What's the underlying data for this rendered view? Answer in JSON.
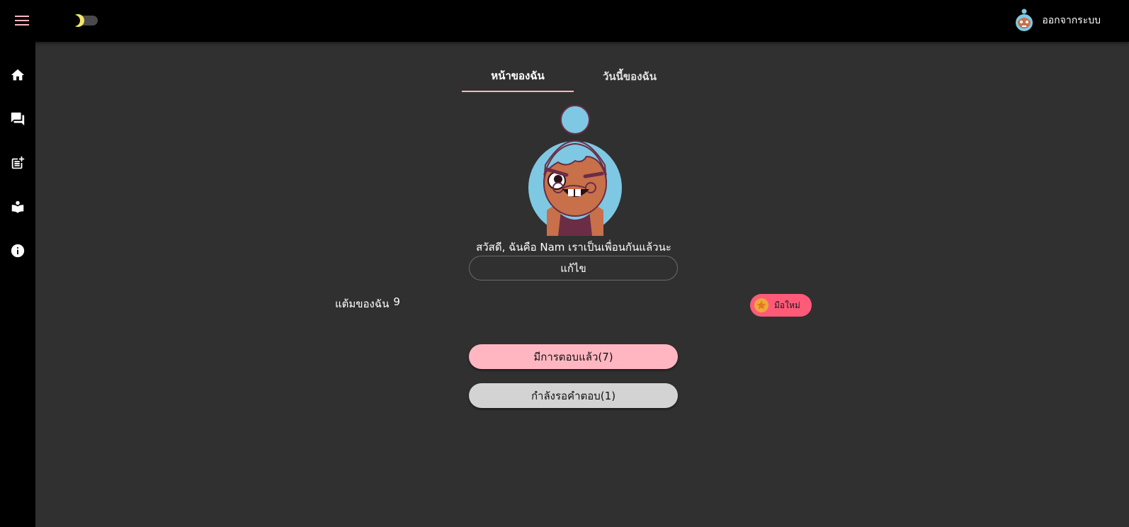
{
  "header": {
    "menu_icon": "hamburger-menu-icon",
    "theme_toggle": {
      "mode": "dark",
      "icon": "moon-icon"
    },
    "logout_label": "ออกจากระบบ"
  },
  "sidebar": {
    "items": [
      {
        "icon": "home-icon"
      },
      {
        "icon": "forum-icon"
      },
      {
        "icon": "post-add-icon"
      },
      {
        "icon": "reading-icon"
      },
      {
        "icon": "info-icon"
      }
    ]
  },
  "tabs": [
    {
      "label": "หน้าของฉัน",
      "active": true
    },
    {
      "label": "วันนี้ของฉัน",
      "active": false
    }
  ],
  "profile": {
    "greeting": "สวัสดี, ฉันคือ Nam เราเป็นเพื่อนกันแล้วนะ",
    "edit_label": "แก้ไข",
    "points_label": "แต้มของฉัน",
    "points_value": "9",
    "rank_badge": "มือใหม่"
  },
  "questions": {
    "answered_label": "มีการตอบแล้ว",
    "answered_count": "7",
    "waiting_label": "กำลังรอคำตอบ",
    "waiting_count": "1"
  },
  "colors": {
    "background": "#303030",
    "bar": "#000000",
    "accent_pink": "#ffb6c1",
    "badge": "#ff5a78",
    "waiting_button": "#d3d3d3"
  }
}
